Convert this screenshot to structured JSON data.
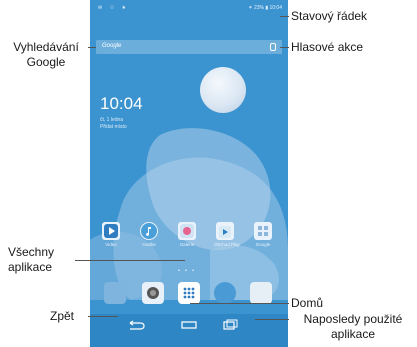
{
  "status_bar": {
    "left_icons": "✉ ☃ ★",
    "right": "✶ 23% ▮ 10:04"
  },
  "search": {
    "logo": "Google"
  },
  "clock": {
    "time": "10:04",
    "date": "čt, 1 ledna",
    "location": "Přidat místo"
  },
  "apps": [
    {
      "label": "Video"
    },
    {
      "label": "Hudba"
    },
    {
      "label": "Galerie"
    },
    {
      "label": "Obchod Play"
    },
    {
      "label": "Google"
    }
  ],
  "annotations": {
    "status_bar": "Stavový řádek",
    "google_search": "Vyhledávání\nGoogle",
    "voice_actions": "Hlasové akce",
    "all_apps": "Všechny\naplikace",
    "home": "Domů",
    "back": "Zpět",
    "recent_apps": "Naposledy použité\naplikace"
  },
  "colors": {
    "wallpaper": "#3b93cf",
    "navbar": "#2f86c4"
  }
}
